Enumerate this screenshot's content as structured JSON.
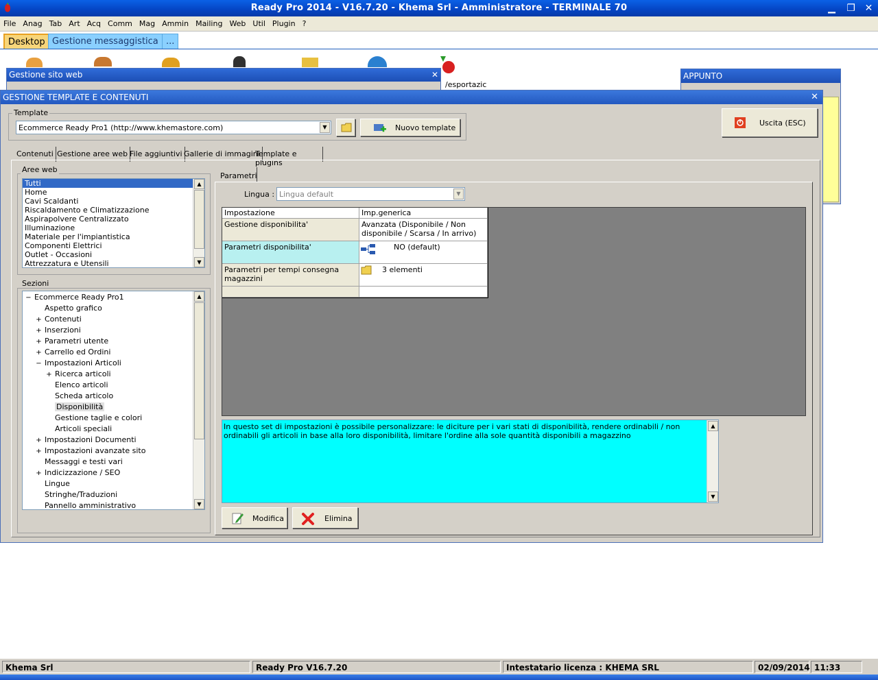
{
  "app": {
    "title": "Ready Pro 2014 - V16.7.20 - Khema Srl - Amministratore - TERMINALE 70"
  },
  "menu": [
    "File",
    "Anag",
    "Tab",
    "Art",
    "Acq",
    "Comm",
    "Mag",
    "Ammin",
    "Mailing",
    "Web",
    "Util",
    "Plugin",
    "?"
  ],
  "window_tabs": [
    "Desktop",
    "Gestione messaggistica",
    "..."
  ],
  "background_windows": {
    "sito_web_title": "Gestione sito web",
    "appunto_title": "APPUNTO",
    "desktop_icon_label": "/esportazic"
  },
  "dialog": {
    "title": "GESTIONE TEMPLATE E CONTENUTI",
    "template_group_label": "Template",
    "template_value": "Ecommerce Ready Pro1 (http://www.khemastore.com)",
    "new_template_label": "Nuovo template",
    "exit_label": "Uscita (ESC)",
    "tabs": [
      "Contenuti",
      "Gestione aree web",
      "File aggiuntivi",
      "Gallerie di immagini",
      "Template e plugins"
    ],
    "aree_web_label": "Aree web",
    "aree_web": [
      "Tutti",
      "Home",
      "Cavi Scaldanti",
      "Riscaldamento e Climatizzazione",
      "Aspirapolvere Centralizzato",
      "Illuminazione",
      "Materiale per l'impiantistica",
      "Componenti Elettrici",
      "Outlet - Occasioni",
      "Attrezzatura e Utensili"
    ],
    "sezioni_label": "Sezioni",
    "sezioni": [
      {
        "label": "Ecommerce Ready Pro1",
        "exp": "−",
        "level": 0
      },
      {
        "label": "Aspetto grafico",
        "exp": "",
        "level": 1
      },
      {
        "label": "Contenuti",
        "exp": "+",
        "level": 1
      },
      {
        "label": "Inserzioni",
        "exp": "+",
        "level": 1
      },
      {
        "label": "Parametri utente",
        "exp": "+",
        "level": 1
      },
      {
        "label": "Carrello ed Ordini",
        "exp": "+",
        "level": 1
      },
      {
        "label": "Impostazioni Articoli",
        "exp": "−",
        "level": 1
      },
      {
        "label": "Ricerca articoli",
        "exp": "+",
        "level": 2
      },
      {
        "label": "Elenco articoli",
        "exp": "",
        "level": 2
      },
      {
        "label": "Scheda articolo",
        "exp": "",
        "level": 2
      },
      {
        "label": "Disponibilità",
        "exp": "",
        "level": 2
      },
      {
        "label": "Gestione taglie e colori",
        "exp": "",
        "level": 2
      },
      {
        "label": "Articoli speciali",
        "exp": "",
        "level": 2
      },
      {
        "label": "Impostazioni Documenti",
        "exp": "+",
        "level": 1
      },
      {
        "label": "Impostazioni avanzate sito",
        "exp": "+",
        "level": 1
      },
      {
        "label": "Messaggi e testi vari",
        "exp": "",
        "level": 1
      },
      {
        "label": "Indicizzazione / SEO",
        "exp": "+",
        "level": 1
      },
      {
        "label": "Lingue",
        "exp": "",
        "level": 1
      },
      {
        "label": "Stringhe/Traduzioni",
        "exp": "",
        "level": 1
      },
      {
        "label": "Pannello amministrativo",
        "exp": "",
        "level": 1
      }
    ],
    "parametri_tab": "Parametri",
    "lingua_label": "Lingua :",
    "lingua_value": "Lingua default",
    "grid": {
      "headers": [
        "Impostazione",
        "Imp.generica"
      ],
      "rows": [
        {
          "name": "Gestione disponibilita'",
          "value": "Avanzata (Disponibile / Non disponibile / Scarsa / In arrivo)"
        },
        {
          "name": "Parametri disponibilita'",
          "value": "NO (default)"
        },
        {
          "name": "Parametri per tempi consegna magazzini",
          "value": "3 elementi"
        }
      ]
    },
    "description": "In questo set di impostazioni è possibile personalizzare: le diciture per i vari stati di disponibilità, rendere ordinabili / non ordinabili gli articoli in base alla loro disponibilità, limitare l'ordine alla sole quantità disponibili a magazzino",
    "modifica_label": "Modifica",
    "elimina_label": "Elimina"
  },
  "status": {
    "company": "Khema Srl",
    "version": "Ready Pro V16.7.20",
    "license": "Intestatario licenza : KHEMA SRL",
    "date": "02/09/2014",
    "time": "11:33"
  },
  "colors": {
    "title_blue": "#0546c6",
    "description_bg": "#00ffff",
    "grid_bg": "#808080",
    "selected_row": "#b8f0f0",
    "appunto_yellow": "#ffff99"
  }
}
